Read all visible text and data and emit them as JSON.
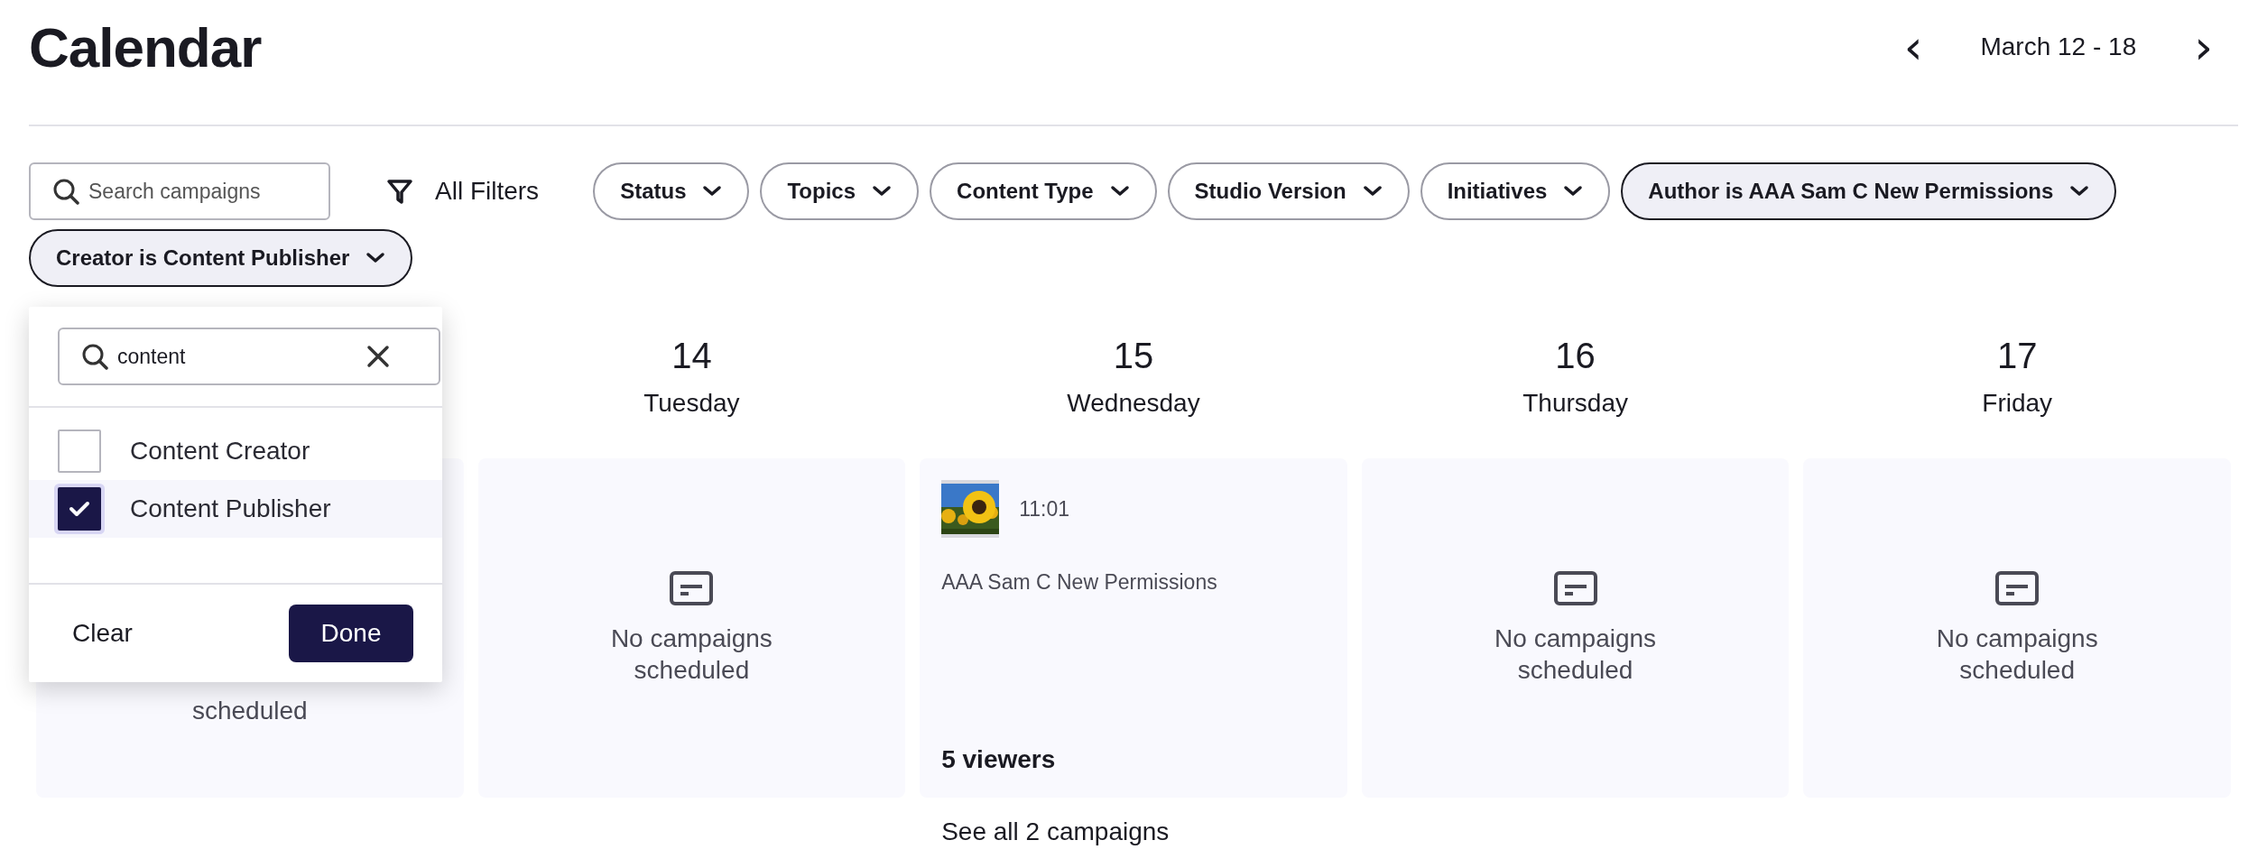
{
  "header": {
    "title": "Calendar",
    "prev": "‹",
    "range": "March 12 - 18",
    "next": "›"
  },
  "search": {
    "placeholder": "Search campaigns"
  },
  "all_filters": "All Filters",
  "filters": [
    {
      "label": "Status",
      "selected": false
    },
    {
      "label": "Topics",
      "selected": false
    },
    {
      "label": "Content Type",
      "selected": false
    },
    {
      "label": "Studio Version",
      "selected": false
    },
    {
      "label": "Initiatives",
      "selected": false
    },
    {
      "label": "Author is AAA Sam C New Permissions",
      "selected": true
    },
    {
      "label": "Creator is Content Publisher",
      "selected": true
    }
  ],
  "dropdown": {
    "search": {
      "value": "content"
    },
    "options": [
      {
        "label": "Content Creator",
        "checked": false
      },
      {
        "label": "Content Publisher",
        "checked": true
      }
    ],
    "clear": "Clear",
    "done": "Done"
  },
  "days": [
    {
      "kind": "empty",
      "message": "scheduled"
    },
    {
      "kind": "empty",
      "number": "14",
      "weekday": "Tuesday",
      "message": "No campaigns scheduled"
    },
    {
      "kind": "campaign",
      "number": "15",
      "weekday": "Wednesday",
      "time": "11:01",
      "name": "AAA Sam C New Permissions",
      "viewers": "5 viewers",
      "see_all": "See all 2 campaigns"
    },
    {
      "kind": "empty",
      "number": "16",
      "weekday": "Thursday",
      "message": "No campaigns scheduled"
    },
    {
      "kind": "empty",
      "number": "17",
      "weekday": "Friday",
      "message": "No campaigns scheduled"
    }
  ]
}
